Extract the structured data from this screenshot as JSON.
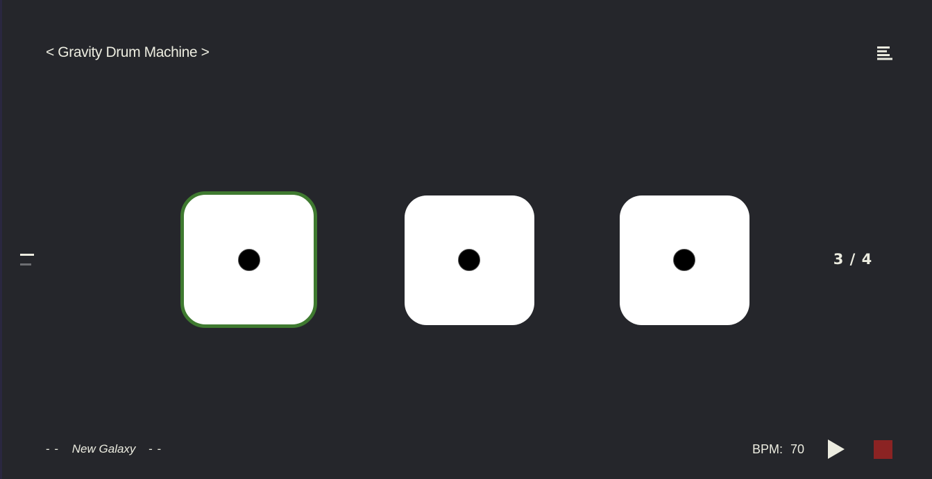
{
  "app": {
    "title": "< Gravity Drum Machine >"
  },
  "menu": {
    "icon": "menu-icon"
  },
  "pager": {
    "label": "3 / 4"
  },
  "pads": [
    {
      "pips": 1,
      "selected": true
    },
    {
      "pips": 1,
      "selected": false
    },
    {
      "pips": 1,
      "selected": false
    }
  ],
  "footer": {
    "dash_left": "- -",
    "song_name": "New Galaxy",
    "dash_right": "- -",
    "bpm_label": "BPM:",
    "bpm_value": "70"
  },
  "transport": {
    "play_icon": "play-icon",
    "stop_icon": "stop-icon"
  },
  "colors": {
    "background": "#25262b",
    "selected_border": "#3f7a30",
    "stop": "#8b2323",
    "text": "#ecece0"
  }
}
